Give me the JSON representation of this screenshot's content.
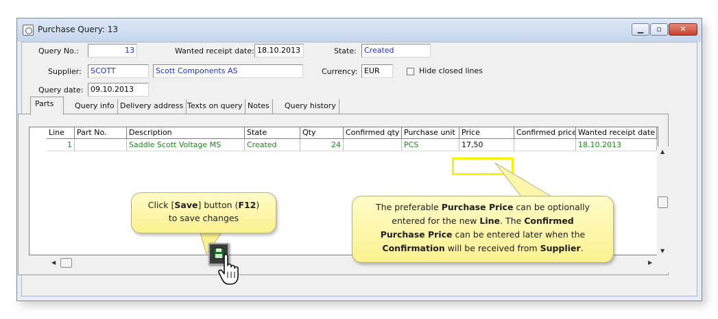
{
  "window": {
    "title": "Purchase Query: 13",
    "buttons": {
      "minimize": "▁",
      "maximize": "▫",
      "close": "✕"
    }
  },
  "header": {
    "query_no_label": "Query No.:",
    "query_no": "13",
    "wanted_label": "Wanted receipt date:",
    "wanted": "18.10.2013",
    "state_label": "State:",
    "state": "Created",
    "supplier_label": "Supplier:",
    "supplier_code": "SCOTT",
    "supplier_name": "Scott Components AS",
    "currency_label": "Currency:",
    "currency": "EUR",
    "hide_closed_label": "Hide closed lines",
    "query_date_label": "Query date:",
    "query_date": "09.10.2013"
  },
  "tabs": [
    "Parts",
    "Query info",
    "Delivery address",
    "Texts on query",
    "Notes",
    "Query history"
  ],
  "grid": {
    "columns": [
      "Line",
      "Part No.",
      "Description",
      "State",
      "Qty",
      "Confirmed qty",
      "Purchase unit",
      "Price",
      "Confirmed price",
      "Wanted receipt date"
    ],
    "rows": [
      {
        "line": "1",
        "part_no": "",
        "description": "Saddle Scott Voltage MS",
        "state": "Created",
        "qty": "24",
        "confirmed_qty": "",
        "purchase_unit": "PCS",
        "price": "17,50",
        "confirmed_price": "",
        "wanted_date": "18.10.2013"
      }
    ]
  },
  "callouts": {
    "save_pre": "Click [",
    "save_word": "Save",
    "save_mid": "] button (",
    "save_key": "F12",
    "save_post": ")",
    "save_line2": "to save changes",
    "price_l1a": "The preferable ",
    "price_l1b": "Purchase Price",
    "price_l1c": " can be optionally",
    "price_l2a": "entered for the new ",
    "price_l2b": "Line",
    "price_l2c": ".  The ",
    "price_l2d": "Confirmed",
    "price_l3a": "Purchase Price",
    "price_l3b": " can be entered later when the",
    "price_l4a": "Confirmation",
    "price_l4b": " will be received from ",
    "price_l4c": "Supplier",
    "price_l4d": "."
  },
  "icons": {
    "app": "query-icon",
    "save": "floppy-disk-icon",
    "cursor": "hand-cursor-icon"
  },
  "colors": {
    "blue_text": "#1a2ed6",
    "green_text": "#1a8a1a",
    "highlight": "#f7f300",
    "callout": "#fbf18f"
  }
}
